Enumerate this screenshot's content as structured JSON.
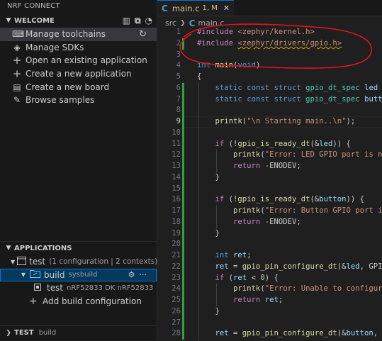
{
  "sidebar": {
    "title": "NRF CONNECT",
    "welcome": {
      "header": "WELCOME",
      "items": [
        {
          "label": "Manage toolchains",
          "icon": "toolchain-icon"
        },
        {
          "label": "Manage SDKs",
          "icon": "sdk-icon"
        },
        {
          "label": "Open an existing application",
          "icon": "plus-icon"
        },
        {
          "label": "Create a new application",
          "icon": "plus-icon"
        },
        {
          "label": "Create a new board",
          "icon": "board-icon"
        },
        {
          "label": "Browse samples",
          "icon": "samples-icon"
        }
      ]
    },
    "applications": {
      "header": "APPLICATIONS",
      "app_name": "test",
      "app_detail": "(1 configuration | 2 contexts)",
      "build_name": "build",
      "build_detail": "sysbuild",
      "target_name": "test",
      "target_detail": "nRF52833 DK nRF52833",
      "add_build": "Add build configuration"
    },
    "test_section": {
      "header": "TEST",
      "detail": "build"
    }
  },
  "editor": {
    "tab": {
      "name": "main.c",
      "status": "1, M"
    },
    "breadcrumb": {
      "folder": "src",
      "file": "main.c"
    },
    "current_line": "9",
    "lines": [
      {
        "n": "1",
        "g": "",
        "html": "<span class='pp'>#include</span> <span class='inc'>&lt;zephyr/kernel.h&gt;</span>"
      },
      {
        "n": "2",
        "g": "mod",
        "html": "<span class='pp'>#include</span> <span class='inc squig'>&lt;zephyr/drivers/gpio.h&gt;</span>"
      },
      {
        "n": "3",
        "g": "",
        "html": ""
      },
      {
        "n": "4",
        "g": "",
        "html": "<span class='kw'>int</span> <span class='fn'>main</span>(<span class='kw'>void</span>)"
      },
      {
        "n": "5",
        "g": "",
        "html": "{"
      },
      {
        "n": "6",
        "g": "add",
        "html": "    <span class='kw'>static</span> <span class='kw'>const</span> <span class='kw'>struct</span> <span class='ty'>gpio_dt_spec</span> <span class='var'>led</span>"
      },
      {
        "n": "7",
        "g": "add",
        "html": "    <span class='kw'>static</span> <span class='kw'>const</span> <span class='kw'>struct</span> <span class='ty'>gpio_dt_spec</span> <span class='var'>butt</span>"
      },
      {
        "n": "8",
        "g": "add",
        "html": ""
      },
      {
        "n": "9",
        "g": "add",
        "html": "    <span class='fn'>printk</span>(<span class='str'>\"\\n Starting main..\\n\"</span>);"
      },
      {
        "n": "10",
        "g": "add",
        "html": ""
      },
      {
        "n": "11",
        "g": "add",
        "html": "    <span class='ctl'>if</span> (!<span class='fn'>gpio_is_ready_dt</span>(&amp;<span class='var'>led</span>)) {"
      },
      {
        "n": "12",
        "g": "add",
        "html": "        <span class='fn'>printk</span>(<span class='str'>\"Error: LED GPIO port is n</span>"
      },
      {
        "n": "13",
        "g": "add",
        "html": "        <span class='ctl'>return</span> -ENODEV;"
      },
      {
        "n": "14",
        "g": "add",
        "html": "    }"
      },
      {
        "n": "15",
        "g": "add",
        "html": ""
      },
      {
        "n": "16",
        "g": "add",
        "html": "    <span class='ctl'>if</span> (!<span class='fn'>gpio_is_ready_dt</span>(&amp;<span class='var'>button</span>)) {"
      },
      {
        "n": "17",
        "g": "add",
        "html": "        <span class='fn'>printk</span>(<span class='str'>\"Error: Button GPIO port i</span>"
      },
      {
        "n": "18",
        "g": "add",
        "html": "        <span class='ctl'>return</span> -ENODEV;"
      },
      {
        "n": "19",
        "g": "add",
        "html": "    }"
      },
      {
        "n": "20",
        "g": "add",
        "html": ""
      },
      {
        "n": "21",
        "g": "add",
        "html": "    <span class='kw'>int</span> <span class='var'>ret</span>;"
      },
      {
        "n": "22",
        "g": "add",
        "html": "    <span class='var'>ret</span> = <span class='fn'>gpio_pin_configure_dt</span>(&amp;<span class='var'>led</span>, GPI"
      },
      {
        "n": "23",
        "g": "add",
        "html": "    <span class='ctl'>if</span> (<span class='var'>ret</span> &lt; <span class='num'>0</span>) {"
      },
      {
        "n": "24",
        "g": "add",
        "html": "        <span class='fn'>printk</span>(<span class='str'>\"Error: Unable to configur</span>"
      },
      {
        "n": "25",
        "g": "add",
        "html": "        <span class='ctl'>return</span> <span class='var'>ret</span>;"
      },
      {
        "n": "26",
        "g": "add",
        "html": "    }"
      },
      {
        "n": "27",
        "g": "add",
        "html": ""
      },
      {
        "n": "28",
        "g": "add",
        "html": "    <span class='var'>ret</span> = <span class='fn'>gpio_pin_configure_dt</span>(&amp;<span class='var'>button</span>,"
      }
    ]
  },
  "colors": {
    "accent": "#0078d4",
    "annotation": "#e0141e",
    "modified": "#e2c08d"
  }
}
